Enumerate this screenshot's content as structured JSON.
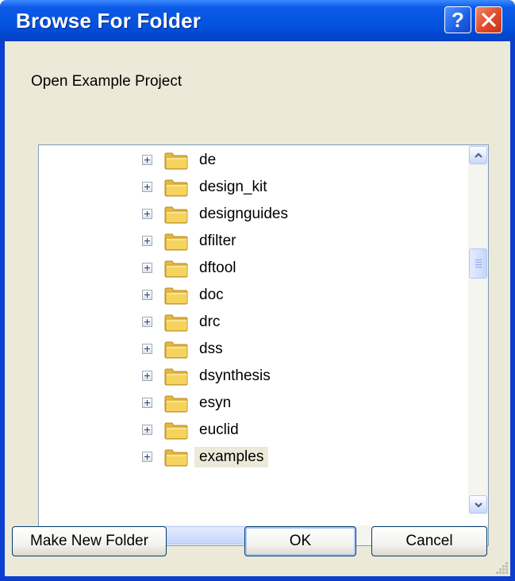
{
  "window": {
    "title": "Browse For Folder",
    "help_label": "?",
    "colors": {
      "titlebar": "#0554e2",
      "client": "#ece9d8",
      "tree_bg": "#ffffff",
      "folder": "#f5d35c"
    }
  },
  "dialog": {
    "prompt": "Open Example Project"
  },
  "tree": {
    "items": [
      {
        "label": "de",
        "icon": "folder-icon",
        "expander": "plus"
      },
      {
        "label": "design_kit",
        "icon": "folder-icon",
        "expander": "plus"
      },
      {
        "label": "designguides",
        "icon": "folder-icon",
        "expander": "plus"
      },
      {
        "label": "dfilter",
        "icon": "folder-icon",
        "expander": "plus"
      },
      {
        "label": "dftool",
        "icon": "folder-icon",
        "expander": "plus"
      },
      {
        "label": "doc",
        "icon": "folder-icon",
        "expander": "plus"
      },
      {
        "label": "drc",
        "icon": "folder-icon",
        "expander": "plus"
      },
      {
        "label": "dss",
        "icon": "folder-icon",
        "expander": "plus"
      },
      {
        "label": "dsynthesis",
        "icon": "folder-icon",
        "expander": "plus"
      },
      {
        "label": "esyn",
        "icon": "folder-icon",
        "expander": "plus"
      },
      {
        "label": "euclid",
        "icon": "folder-icon",
        "expander": "plus"
      },
      {
        "label": "examples",
        "icon": "folder-icon",
        "expander": "plus",
        "selected": true
      }
    ],
    "selected_item": "examples"
  },
  "buttons": {
    "make_new_folder": "Make New Folder",
    "ok": "OK",
    "cancel": "Cancel"
  }
}
